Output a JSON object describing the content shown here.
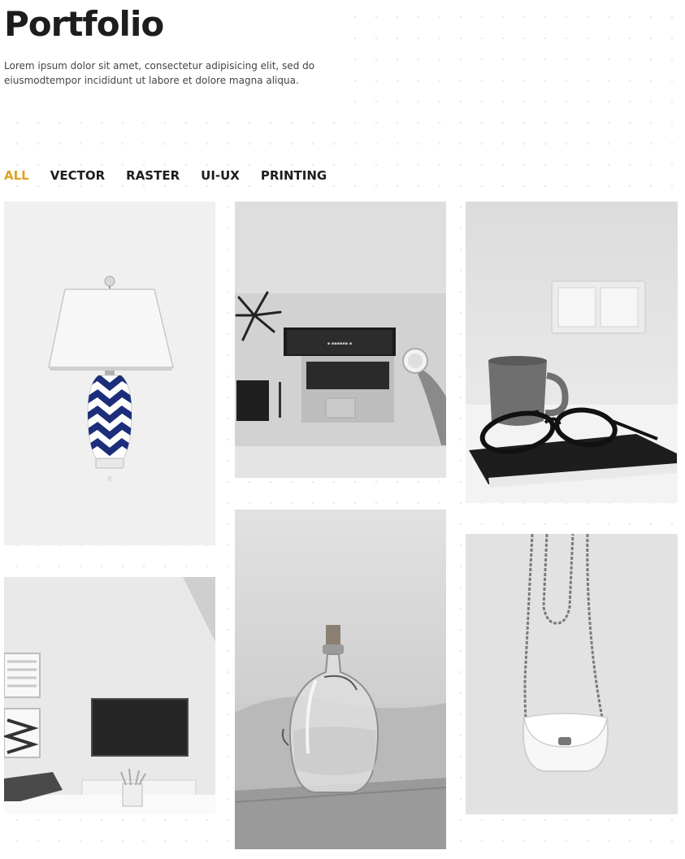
{
  "header": {
    "title": "Portfolio",
    "subtitle": "Lorem ipsum dolor sit amet, consectetur adipisicing elit, sed do eiusmodtempor incididunt ut labore et dolore magna aliqua."
  },
  "filters": [
    {
      "label": "ALL",
      "active": true
    },
    {
      "label": "VECTOR",
      "active": false
    },
    {
      "label": "RASTER",
      "active": false
    },
    {
      "label": "UI-UX",
      "active": false
    },
    {
      "label": "PRINTING",
      "active": false
    }
  ],
  "colors": {
    "accent": "#e0a123",
    "text": "#1e1e1e"
  },
  "gallery": [
    {
      "subject": "table-lamp"
    },
    {
      "subject": "laptop-desk"
    },
    {
      "subject": "mug-glasses-notebook"
    },
    {
      "subject": "living-room-tv"
    },
    {
      "subject": "glass-bottle"
    },
    {
      "subject": "white-bag-necklace"
    }
  ]
}
